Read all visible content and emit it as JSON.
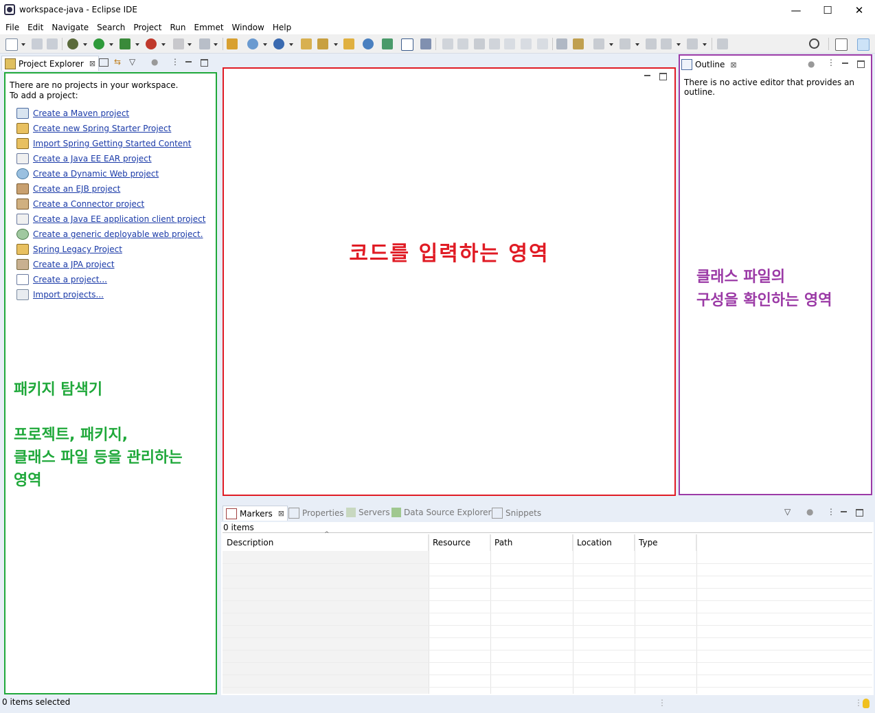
{
  "window": {
    "title": "workspace-java - Eclipse IDE",
    "controls": {
      "minimize": "—",
      "maximize": "☐",
      "close": "✕"
    }
  },
  "menu": [
    "File",
    "Edit",
    "Navigate",
    "Search",
    "Project",
    "Run",
    "Emmet",
    "Window",
    "Help"
  ],
  "project_explorer": {
    "tab_label": "Project Explorer",
    "empty_line1": "There are no projects in your workspace.",
    "empty_line2": "To add a project:",
    "links": [
      "Create a Maven project",
      "Create new Spring Starter Project",
      "Import Spring Getting Started Content",
      "Create a Java EE EAR project",
      "Create a Dynamic Web project",
      "Create an EJB project",
      "Create a Connector project",
      "Create a Java EE application client project",
      "Create a generic deployable web project.",
      "Spring Legacy Project",
      "Create a JPA project",
      "Create a project...",
      "Import projects..."
    ],
    "annotation_title": "패키지 탐색기",
    "annotation_line1": "프로젝트, 패키지,",
    "annotation_line2": "클래스 파일 등을 관리하는",
    "annotation_line3": "영역",
    "annotation_color": "#1fa83a"
  },
  "editor": {
    "annotation": "코드를 입력하는 영역",
    "annotation_color": "#e01b24"
  },
  "outline": {
    "tab_label": "Outline",
    "message": "There is no active editor that provides an outline.",
    "annotation_line1": "클래스 파일의",
    "annotation_line2": "구성을 확인하는 영역",
    "annotation_color": "#9b3aa6"
  },
  "bottom": {
    "tabs": [
      "Markers",
      "Properties",
      "Servers",
      "Data Source Explorer",
      "Snippets"
    ],
    "items_count": "0 items",
    "columns": [
      "Description",
      "Resource",
      "Path",
      "Location",
      "Type"
    ]
  },
  "status": {
    "text": "0 items selected"
  },
  "colors": {
    "background": "#e8eef7",
    "link": "#1a3aa8"
  }
}
